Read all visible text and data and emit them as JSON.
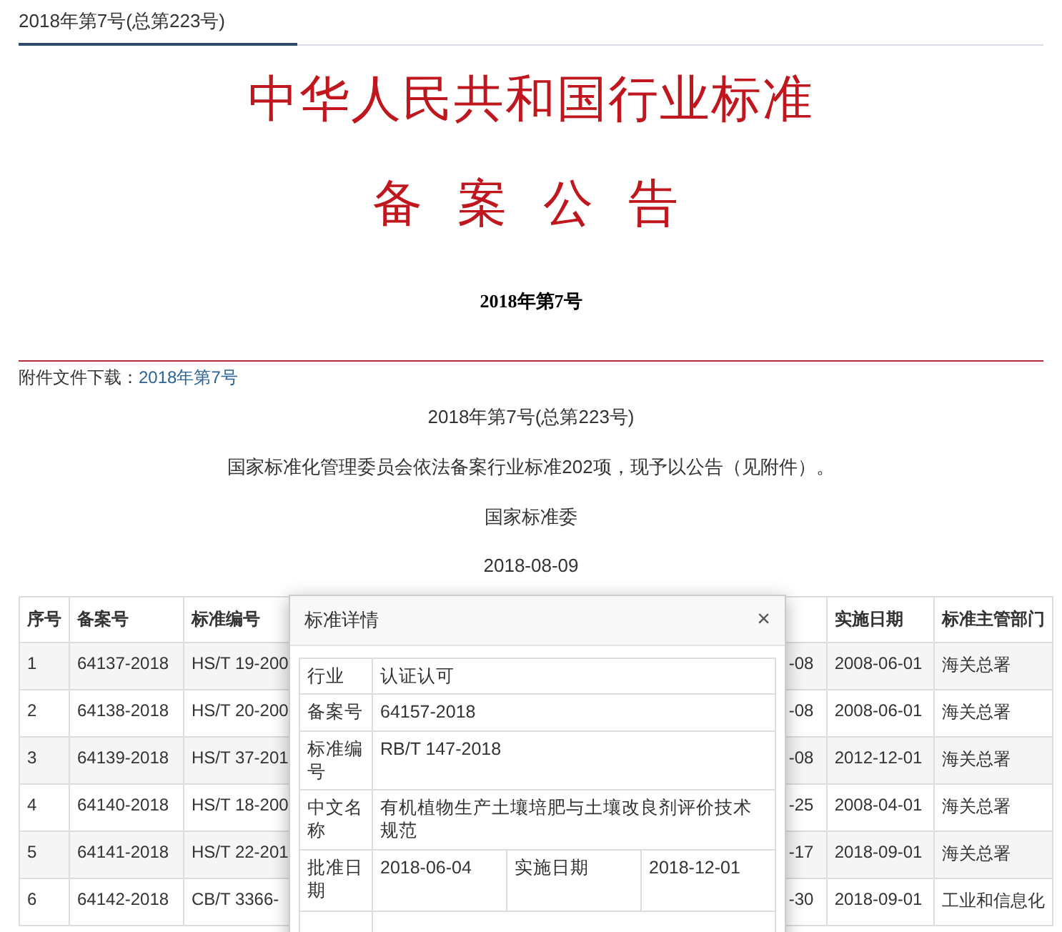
{
  "issue_tab": "2018年第7号(总第223号)",
  "heading": {
    "title": "中华人民共和国行业标准",
    "subtitle": "备 案 公 告",
    "number": "2018年第7号"
  },
  "attachment": {
    "label": "附件文件下载：",
    "link": "2018年第7号"
  },
  "notice": {
    "lines": [
      "2018年第7号(总第223号)",
      "国家标准化管理委员会依法备案行业标准202项，现予以公告（见附件）。",
      "国家标准委",
      "2018-08-09"
    ]
  },
  "table": {
    "columns": [
      {
        "label": "序号"
      },
      {
        "label": "备案号"
      },
      {
        "label": "标准编号"
      },
      {},
      {
        "label": "实施日期"
      },
      {
        "label": "标准主管部门"
      }
    ],
    "rows": [
      {
        "cells": [
          "1",
          "64137-2018",
          "HS/T 19-200",
          "-08",
          "2008-06-01",
          "海关总署"
        ]
      },
      {
        "cells": [
          "2",
          "64138-2018",
          "HS/T 20-200",
          "-08",
          "2008-06-01",
          "海关总署"
        ]
      },
      {
        "cells": [
          "3",
          "64139-2018",
          "HS/T 37-201",
          "-08",
          "2012-12-01",
          "海关总署"
        ]
      },
      {
        "cells": [
          "4",
          "64140-2018",
          "HS/T 18-200",
          "-25",
          "2008-04-01",
          "海关总署"
        ]
      },
      {
        "cells": [
          "5",
          "64141-2018",
          "HS/T 22-201",
          "-17",
          "2018-09-01",
          "海关总署"
        ]
      },
      {
        "cells": [
          "6",
          "64142-2018",
          "CB/T 3366-",
          "-30",
          "2018-09-01",
          "工业和信息化"
        ]
      }
    ]
  },
  "dialog": {
    "title": "标准详情",
    "close": "×",
    "fields": [
      {
        "label": "行业",
        "value": "认证认可"
      },
      {
        "label": "备案号",
        "value": "64157-2018"
      },
      {
        "label": "标准编号",
        "value": "RB/T 147-2018"
      },
      {
        "label": "中文名称",
        "value": "有机植物生产土壤培肥与土壤改良剂评价技术规范"
      }
    ],
    "dates": [
      {
        "label": "批准日期",
        "value": "2018-06-04"
      },
      {
        "label": "实施日期",
        "value": "2018-12-01"
      }
    ]
  }
}
